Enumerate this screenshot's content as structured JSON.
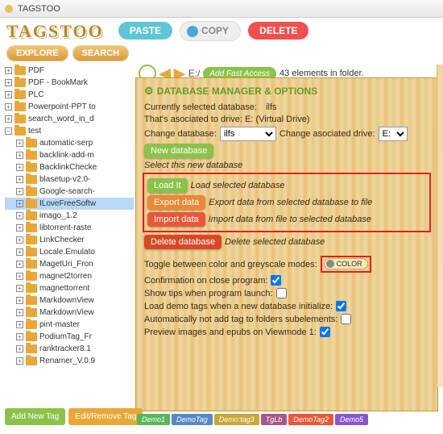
{
  "window": {
    "title": "TAGSTOO"
  },
  "logo": "TAGSTOO",
  "top": {
    "paste": "PASTE",
    "copy": "COPY",
    "delete": "DELETE"
  },
  "nav": {
    "explore": "EXPLORE",
    "search": "SEARCH"
  },
  "path": {
    "drive": "E:/",
    "add_fast": "Add Fast Access",
    "count": "43 elements in folder."
  },
  "tree": [
    {
      "label": "PDF",
      "n": 0
    },
    {
      "label": "PDF - BookMark",
      "n": 0
    },
    {
      "label": "PLC",
      "n": 0
    },
    {
      "label": "Powerpoint-PPT to",
      "n": 0
    },
    {
      "label": "search_word_in_d",
      "n": 0
    },
    {
      "label": "test",
      "n": 0,
      "open": true
    },
    {
      "label": "automatic-serp",
      "n": 1
    },
    {
      "label": "backlink-add-m",
      "n": 1
    },
    {
      "label": "BacklinkChecke",
      "n": 1
    },
    {
      "label": "blasetup-v2.0-",
      "n": 1
    },
    {
      "label": "Google-search-",
      "n": 1
    },
    {
      "label": "ILoveFreeSoftw",
      "n": 1,
      "sel": true
    },
    {
      "label": "imago_1.2",
      "n": 1
    },
    {
      "label": "libtorrent-raste",
      "n": 1
    },
    {
      "label": "LinkChecker",
      "n": 1
    },
    {
      "label": "Locale.Emulato",
      "n": 1
    },
    {
      "label": "MagetUri_Fron",
      "n": 1
    },
    {
      "label": "magnet2torren",
      "n": 1
    },
    {
      "label": "magnettorrent",
      "n": 1
    },
    {
      "label": "MarkdownView",
      "n": 1
    },
    {
      "label": "MarkdownView",
      "n": 1
    },
    {
      "label": "pint-master",
      "n": 1
    },
    {
      "label": "PodiumTag_Fr",
      "n": 1
    },
    {
      "label": "ranktracker8.1",
      "n": 1
    },
    {
      "label": "Renamer_V.0.9",
      "n": 1
    }
  ],
  "panel": {
    "title": "DATABASE MANAGER & OPTIONS",
    "cur_db_label": "Currently selected database:",
    "cur_db": "ilfs",
    "assoc_label": "That's asociated to drive: E: (Virtual Drive)",
    "change_db_label": "Change database:",
    "change_db_val": "ilfs",
    "change_drive_label": "Change asociated drive:",
    "change_drive_val": "E:",
    "new_db": "New database",
    "select_new": "Select this new database",
    "load_it": "Load It",
    "load_it_desc": "Load selected database",
    "export": "Export data",
    "export_desc": "Export data from selected database to file",
    "import": "Import data",
    "import_desc": "Import data from file to selected database",
    "del_db": "Delete database",
    "del_db_desc": "Delete selected database",
    "toggle_label": "Toggle between color and greyscale modes:",
    "toggle_val": "COLOR",
    "opt1": "Confirmation on close program:",
    "opt2": "Show tips when program launch:",
    "opt3": "Load demo tags when a new database initialize:",
    "opt4": "Automatically not add tag to folders subelements:",
    "opt5": "Preview images and epubs on Viewmode 1:"
  },
  "bottom": {
    "add": "Add New Tag",
    "edit": "Edit/Remove Tag",
    "tags": [
      {
        "t": "Demo1",
        "c": "#58b858"
      },
      {
        "t": "DemoTag",
        "c": "#5888c8"
      },
      {
        "t": "Demo:tag3",
        "c": "#c8a838"
      },
      {
        "t": "TgLb",
        "c": "#a85888"
      },
      {
        "t": "DemoTag2",
        "c": "#e85838"
      },
      {
        "t": "Demo5",
        "c": "#8858c8"
      }
    ]
  }
}
